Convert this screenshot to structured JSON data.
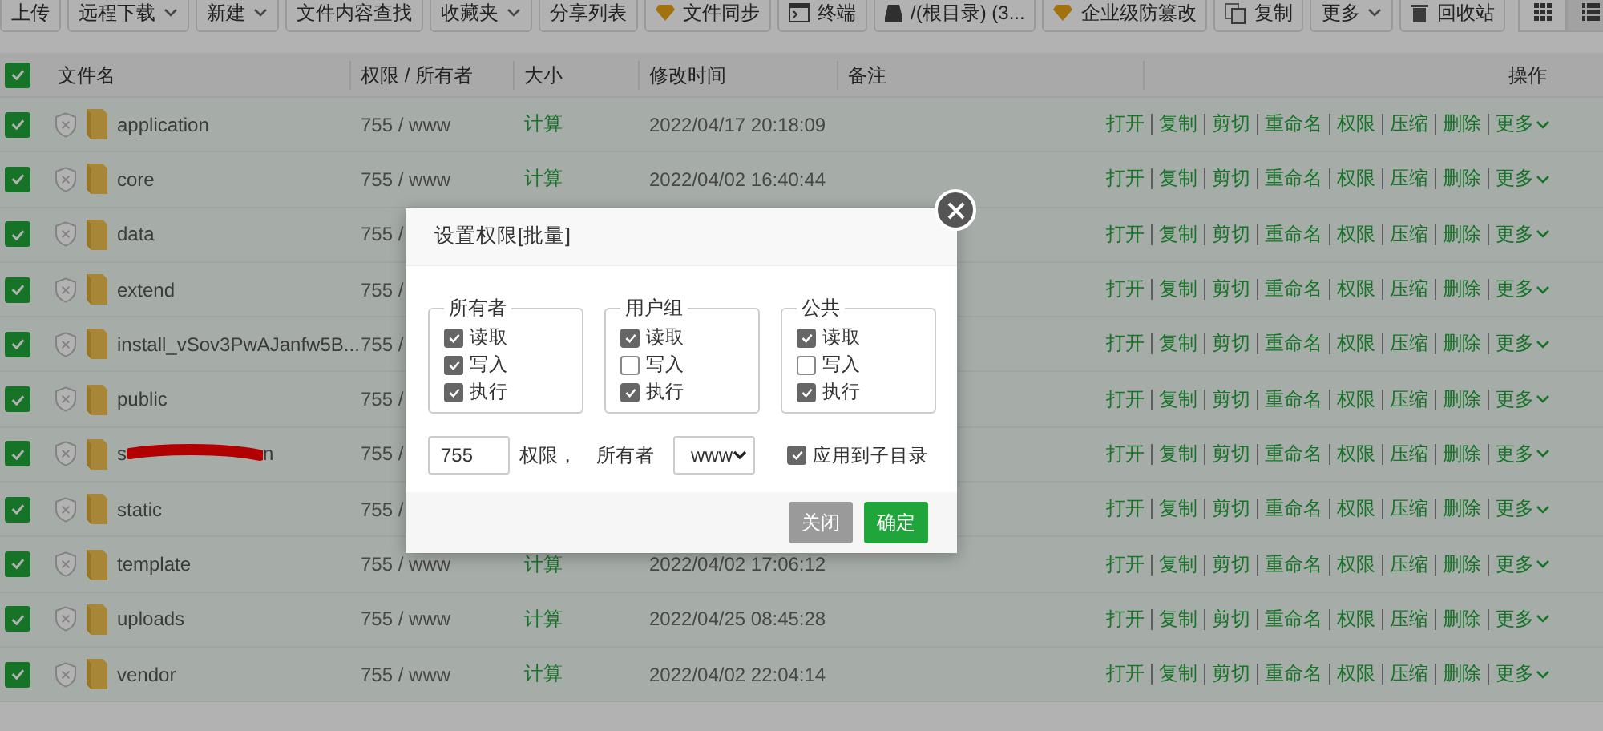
{
  "toolbar": {
    "buttons": [
      {
        "label": "上传",
        "kind": "plain"
      },
      {
        "label": "远程下载",
        "kind": "dropdown"
      },
      {
        "label": "新建",
        "kind": "dropdown"
      },
      {
        "label": "文件内容查找",
        "kind": "plain"
      },
      {
        "label": "收藏夹",
        "kind": "dropdown"
      },
      {
        "label": "分享列表",
        "kind": "plain"
      },
      {
        "label": "文件同步",
        "kind": "gem"
      },
      {
        "label": "终端",
        "kind": "terminal"
      },
      {
        "label": "/(根目录) (3...",
        "kind": "disk"
      },
      {
        "label": "企业级防篡改",
        "kind": "gem"
      },
      {
        "label": "复制",
        "kind": "copy"
      },
      {
        "label": "更多",
        "kind": "dropdown"
      },
      {
        "label": "回收站",
        "kind": "trash"
      }
    ],
    "views": [
      {
        "kind": "grid",
        "selected": false
      },
      {
        "kind": "list",
        "selected": true
      }
    ]
  },
  "table": {
    "all_checked": true,
    "columns": [
      "文件名",
      "权限 / 所有者",
      "大小",
      "修改时间",
      "备注",
      "操作"
    ],
    "rows": [
      {
        "checked": true,
        "name": "application",
        "perm": "755 / www",
        "size": "计算",
        "time": "2022/04/17 20:18:09",
        "actions": [
          "打开",
          "复制",
          "剪切",
          "重命名",
          "权限",
          "压缩",
          "删除",
          "更多"
        ]
      },
      {
        "checked": true,
        "name": "core",
        "perm": "755 / www",
        "size": "计算",
        "time": "2022/04/02 16:40:44",
        "actions": [
          "打开",
          "复制",
          "剪切",
          "重命名",
          "权限",
          "压缩",
          "删除",
          "更多"
        ]
      },
      {
        "checked": true,
        "name": "data",
        "perm": "755 /",
        "actions": [
          "打开",
          "复制",
          "剪切",
          "重命名",
          "权限",
          "压缩",
          "删除",
          "更多"
        ]
      },
      {
        "checked": true,
        "name": "extend",
        "perm": "755 /",
        "actions": [
          "打开",
          "复制",
          "剪切",
          "重命名",
          "权限",
          "压缩",
          "删除",
          "更多"
        ]
      },
      {
        "checked": true,
        "name": "install_vSov3PwAJanfw5B...",
        "perm": "755 /",
        "actions": [
          "打开",
          "复制",
          "剪切",
          "重命名",
          "权限",
          "压缩",
          "删除",
          "更多"
        ]
      },
      {
        "checked": true,
        "name": "public",
        "perm": "755 /",
        "actions": [
          "打开",
          "复制",
          "剪切",
          "重命名",
          "权限",
          "压缩",
          "删除",
          "更多"
        ]
      },
      {
        "checked": true,
        "name": "s",
        "name_end": "n",
        "redacted": true,
        "perm": "755 /",
        "actions": [
          "打开",
          "复制",
          "剪切",
          "重命名",
          "权限",
          "压缩",
          "删除",
          "更多"
        ]
      },
      {
        "checked": true,
        "name": "static",
        "perm": "755 /",
        "actions": [
          "打开",
          "复制",
          "剪切",
          "重命名",
          "权限",
          "压缩",
          "删除",
          "更多"
        ]
      },
      {
        "checked": true,
        "name": "template",
        "perm": "755 / www",
        "size": "计算",
        "time": "2022/04/02 17:06:12",
        "actions": [
          "打开",
          "复制",
          "剪切",
          "重命名",
          "权限",
          "压缩",
          "删除",
          "更多"
        ]
      },
      {
        "checked": true,
        "name": "uploads",
        "perm": "755 / www",
        "size": "计算",
        "time": "2022/04/25 08:45:28",
        "actions": [
          "打开",
          "复制",
          "剪切",
          "重命名",
          "权限",
          "压缩",
          "删除",
          "更多"
        ]
      },
      {
        "checked": true,
        "name": "vendor",
        "perm": "755 / www",
        "size": "计算",
        "time": "2022/04/02 22:04:14",
        "actions": [
          "打开",
          "复制",
          "剪切",
          "重命名",
          "权限",
          "压缩",
          "删除",
          "更多"
        ]
      }
    ]
  },
  "dialog": {
    "title": "设置权限[批量]",
    "groups": [
      {
        "label": "所有者",
        "perms": [
          {
            "label": "读取",
            "checked": true
          },
          {
            "label": "写入",
            "checked": true
          },
          {
            "label": "执行",
            "checked": true
          }
        ]
      },
      {
        "label": "用户组",
        "perms": [
          {
            "label": "读取",
            "checked": true
          },
          {
            "label": "写入",
            "checked": false
          },
          {
            "label": "执行",
            "checked": true
          }
        ]
      },
      {
        "label": "公共",
        "perms": [
          {
            "label": "读取",
            "checked": true
          },
          {
            "label": "写入",
            "checked": false
          },
          {
            "label": "执行",
            "checked": true
          }
        ]
      }
    ],
    "mode_value": "755",
    "mode_label": "权限，",
    "owner_label": "所有者",
    "owner_value": "www",
    "apply_sub": {
      "label": "应用到子目录",
      "checked": true
    },
    "buttons": [
      {
        "label": "关闭",
        "kind": "cancel"
      },
      {
        "label": "确定",
        "kind": "primary"
      }
    ]
  }
}
